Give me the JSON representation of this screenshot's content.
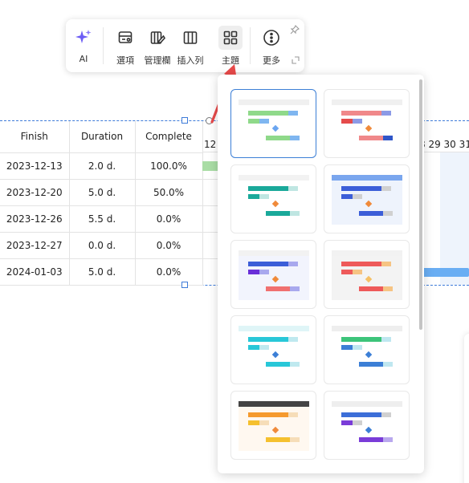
{
  "toolbar": {
    "items": [
      {
        "label": "AI",
        "icon": "sparkle-icon"
      },
      {
        "label": "選項",
        "icon": "options-icon"
      },
      {
        "label": "管理欄",
        "icon": "manage-columns-icon"
      },
      {
        "label": "插入列",
        "icon": "insert-column-icon"
      },
      {
        "label": "主題",
        "icon": "theme-grid-icon",
        "active": true
      },
      {
        "label": "更多",
        "icon": "more-icon"
      }
    ],
    "accent": "#6c5cf5"
  },
  "table": {
    "headers": {
      "finish": "Finish",
      "duration": "Duration",
      "complete": "Complete"
    },
    "rows": [
      {
        "finish": "2023-12-13",
        "duration": "2.0 d.",
        "complete": "100.0%"
      },
      {
        "finish": "2023-12-20",
        "duration": "5.0 d.",
        "complete": "50.0%"
      },
      {
        "finish": "2023-12-26",
        "duration": "5.5 d.",
        "complete": "0.0%"
      },
      {
        "finish": "2023-12-27",
        "duration": "0.0 d.",
        "complete": "0.0%"
      },
      {
        "finish": "2024-01-03",
        "duration": "5.0 d.",
        "complete": "0.0%"
      }
    ]
  },
  "timeline": {
    "left_day": "12",
    "right_days": "8 29 30 31"
  },
  "themes": [
    {
      "name": "green-blue",
      "bar1": "#8fd98a",
      "bar1b": "#7fb6f0",
      "bar2": "#8fd98a",
      "diamond": "#6aa5f0",
      "bar3": "#8fd98a",
      "bar3b": "#7fb6f0",
      "header": "#f0f0f0",
      "bg": "#ffffff",
      "selected": true
    },
    {
      "name": "coral-navy",
      "bar1": "#f0888a",
      "bar1b": "#8c9ae6",
      "bar2": "#e54b4b",
      "diamond": "#f08a3a",
      "bar3": "#f0888a",
      "bar3b": "#2f56c8",
      "header": "#f0f0f0",
      "bg": "#ffffff"
    },
    {
      "name": "teal",
      "bar1": "#1aa99a",
      "bar1b": "#bfe6e2",
      "bar2": "#1aa99a",
      "diamond": "#f08a3a",
      "bar3": "#1aa99a",
      "bar3b": "#bfe6e2",
      "header": "#f2f2f2",
      "bg": "#ffffff"
    },
    {
      "name": "royal-blue",
      "bar1": "#3c5ed8",
      "bar1b": "#d0d0d0",
      "bar2": "#3c5ed8",
      "diamond": "#f08a3a",
      "bar3": "#3c5ed8",
      "bar3b": "#d0d0d0",
      "header": "#7aa6ee",
      "bg": "#eef3fc"
    },
    {
      "name": "indigo-lavender",
      "bar1": "#3c5ed8",
      "bar1b": "#a8a8ee",
      "bar2": "#6a2fd8",
      "diamond": "#f08a3a",
      "bar3": "#f07070",
      "bar3b": "#a8a8ee",
      "header": "#f2f2f2",
      "bg": "#f2f4fd"
    },
    {
      "name": "red-amber",
      "bar1": "#ee5a5a",
      "bar1b": "#f6c483",
      "bar2": "#ee5a5a",
      "diamond": "#f6c064",
      "bar3": "#ee5a5a",
      "bar3b": "#f6c483",
      "header": "#f2f2f2",
      "bg": "#f3f3f3"
    },
    {
      "name": "cyan",
      "bar1": "#28c7d8",
      "bar1b": "#bfe9ef",
      "bar2": "#28c7d8",
      "diamond": "#3c7fd6",
      "bar3": "#28c7d8",
      "bar3b": "#bfe9ef",
      "header": "#dff5f7",
      "bg": "#ffffff"
    },
    {
      "name": "green-sky",
      "bar1": "#3cc47a",
      "bar1b": "#bfe7f0",
      "bar2": "#3c7fd6",
      "diamond": "#3c7fd6",
      "bar3": "#3c7fd6",
      "bar3b": "#bfe7f0",
      "header": "#eeeeee",
      "bg": "#ffffff"
    },
    {
      "name": "orange-gold",
      "bar1": "#f59a2e",
      "bar1b": "#f6ddb8",
      "bar2": "#f5c02e",
      "diamond": "#f08a3a",
      "bar3": "#f5c02e",
      "bar3b": "#f6ddb8",
      "header": "#444444",
      "bg": "#fff8f0"
    },
    {
      "name": "blue-purple",
      "bar1": "#3c6ed8",
      "bar1b": "#d0d0d0",
      "bar2": "#7a3cd8",
      "diamond": "#3c7fd6",
      "bar3": "#7a3cd8",
      "bar3b": "#b9a8ee",
      "header": "#eeeeee",
      "bg": "#ffffff"
    }
  ]
}
